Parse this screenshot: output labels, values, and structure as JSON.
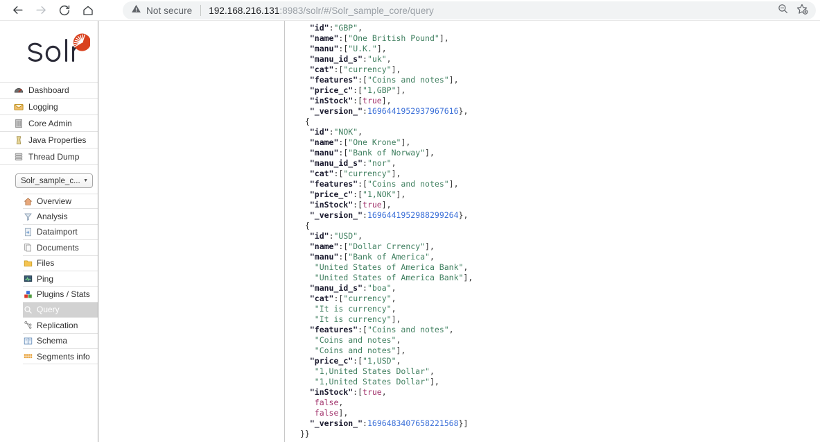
{
  "browser": {
    "back_icon": "back-arrow-icon",
    "forward_icon": "forward-arrow-icon",
    "reload_icon": "reload-icon",
    "home_icon": "home-icon",
    "security_icon": "not-secure-warning-icon",
    "security_label": "Not secure",
    "url_host": "192.168.216.131",
    "url_path": ":8983/solr/#/Solr_sample_core/query",
    "url_full": "192.168.216.131:8983/solr/#/Solr_sample_core/query",
    "zoom_out_icon": "zoom-out-icon",
    "favorite_icon": "add-to-favorites-star-icon"
  },
  "sidebar": {
    "logo_text": "Solr",
    "main_nav": [
      {
        "label": "Dashboard",
        "icon": "dashboard-icon"
      },
      {
        "label": "Logging",
        "icon": "logging-icon"
      },
      {
        "label": "Core Admin",
        "icon": "core-admin-icon"
      },
      {
        "label": "Java Properties",
        "icon": "java-properties-icon"
      },
      {
        "label": "Thread Dump",
        "icon": "thread-dump-icon"
      }
    ],
    "core_selector": {
      "value": "Solr_sample_c...",
      "caret": "▼"
    },
    "core_nav": [
      {
        "label": "Overview",
        "icon": "overview-icon",
        "active": false
      },
      {
        "label": "Analysis",
        "icon": "analysis-icon",
        "active": false
      },
      {
        "label": "Dataimport",
        "icon": "dataimport-icon",
        "active": false
      },
      {
        "label": "Documents",
        "icon": "documents-icon",
        "active": false
      },
      {
        "label": "Files",
        "icon": "files-folder-icon",
        "active": false
      },
      {
        "label": "Ping",
        "icon": "ping-icon",
        "active": false
      },
      {
        "label": "Plugins / Stats",
        "icon": "plugins-stats-icon",
        "active": false
      },
      {
        "label": "Query",
        "icon": "query-magnifier-icon",
        "active": true
      },
      {
        "label": "Replication",
        "icon": "replication-icon",
        "active": false
      },
      {
        "label": "Schema",
        "icon": "schema-book-icon",
        "active": false
      },
      {
        "label": "Segments info",
        "icon": "segments-info-icon",
        "active": false
      }
    ]
  },
  "response": {
    "lines": [
      [
        {
          "t": "key",
          "v": "\"id\""
        },
        {
          "t": "punct",
          "v": ":"
        },
        {
          "t": "str",
          "v": "\"GBP\""
        },
        {
          "t": "punct",
          "v": ","
        }
      ],
      [
        {
          "t": "key",
          "v": "\"name\""
        },
        {
          "t": "punct",
          "v": ":["
        },
        {
          "t": "str",
          "v": "\"One British Pound\""
        },
        {
          "t": "punct",
          "v": "],"
        }
      ],
      [
        {
          "t": "key",
          "v": "\"manu\""
        },
        {
          "t": "punct",
          "v": ":["
        },
        {
          "t": "str",
          "v": "\"U.K.\""
        },
        {
          "t": "punct",
          "v": "],"
        }
      ],
      [
        {
          "t": "key",
          "v": "\"manu_id_s\""
        },
        {
          "t": "punct",
          "v": ":"
        },
        {
          "t": "str",
          "v": "\"uk\""
        },
        {
          "t": "punct",
          "v": ","
        }
      ],
      [
        {
          "t": "key",
          "v": "\"cat\""
        },
        {
          "t": "punct",
          "v": ":["
        },
        {
          "t": "str",
          "v": "\"currency\""
        },
        {
          "t": "punct",
          "v": "],"
        }
      ],
      [
        {
          "t": "key",
          "v": "\"features\""
        },
        {
          "t": "punct",
          "v": ":["
        },
        {
          "t": "str",
          "v": "\"Coins and notes\""
        },
        {
          "t": "punct",
          "v": "],"
        }
      ],
      [
        {
          "t": "key",
          "v": "\"price_c\""
        },
        {
          "t": "punct",
          "v": ":["
        },
        {
          "t": "str",
          "v": "\"1,GBP\""
        },
        {
          "t": "punct",
          "v": "],"
        }
      ],
      [
        {
          "t": "key",
          "v": "\"inStock\""
        },
        {
          "t": "punct",
          "v": ":["
        },
        {
          "t": "bool",
          "v": "true"
        },
        {
          "t": "punct",
          "v": "],"
        }
      ],
      [
        {
          "t": "key",
          "v": "\"_version_\""
        },
        {
          "t": "punct",
          "v": ":"
        },
        {
          "t": "num",
          "v": "1696441952937967616"
        },
        {
          "t": "punct",
          "v": "},"
        }
      ],
      [
        {
          "t": "brace",
          "v": "{",
          "indent": -1
        }
      ],
      [
        {
          "t": "key",
          "v": "\"id\""
        },
        {
          "t": "punct",
          "v": ":"
        },
        {
          "t": "str",
          "v": "\"NOK\""
        },
        {
          "t": "punct",
          "v": ","
        }
      ],
      [
        {
          "t": "key",
          "v": "\"name\""
        },
        {
          "t": "punct",
          "v": ":["
        },
        {
          "t": "str",
          "v": "\"One Krone\""
        },
        {
          "t": "punct",
          "v": "],"
        }
      ],
      [
        {
          "t": "key",
          "v": "\"manu\""
        },
        {
          "t": "punct",
          "v": ":["
        },
        {
          "t": "str",
          "v": "\"Bank of Norway\""
        },
        {
          "t": "punct",
          "v": "],"
        }
      ],
      [
        {
          "t": "key",
          "v": "\"manu_id_s\""
        },
        {
          "t": "punct",
          "v": ":"
        },
        {
          "t": "str",
          "v": "\"nor\""
        },
        {
          "t": "punct",
          "v": ","
        }
      ],
      [
        {
          "t": "key",
          "v": "\"cat\""
        },
        {
          "t": "punct",
          "v": ":["
        },
        {
          "t": "str",
          "v": "\"currency\""
        },
        {
          "t": "punct",
          "v": "],"
        }
      ],
      [
        {
          "t": "key",
          "v": "\"features\""
        },
        {
          "t": "punct",
          "v": ":["
        },
        {
          "t": "str",
          "v": "\"Coins and notes\""
        },
        {
          "t": "punct",
          "v": "],"
        }
      ],
      [
        {
          "t": "key",
          "v": "\"price_c\""
        },
        {
          "t": "punct",
          "v": ":["
        },
        {
          "t": "str",
          "v": "\"1,NOK\""
        },
        {
          "t": "punct",
          "v": "],"
        }
      ],
      [
        {
          "t": "key",
          "v": "\"inStock\""
        },
        {
          "t": "punct",
          "v": ":["
        },
        {
          "t": "bool",
          "v": "true"
        },
        {
          "t": "punct",
          "v": "],"
        }
      ],
      [
        {
          "t": "key",
          "v": "\"_version_\""
        },
        {
          "t": "punct",
          "v": ":"
        },
        {
          "t": "num",
          "v": "1696441952988299264"
        },
        {
          "t": "punct",
          "v": "},"
        }
      ],
      [
        {
          "t": "brace",
          "v": "{",
          "indent": -1
        }
      ],
      [
        {
          "t": "key",
          "v": "\"id\""
        },
        {
          "t": "punct",
          "v": ":"
        },
        {
          "t": "str",
          "v": "\"USD\""
        },
        {
          "t": "punct",
          "v": ","
        }
      ],
      [
        {
          "t": "key",
          "v": "\"name\""
        },
        {
          "t": "punct",
          "v": ":["
        },
        {
          "t": "str",
          "v": "\"Dollar Crrency\""
        },
        {
          "t": "punct",
          "v": "],"
        }
      ],
      [
        {
          "t": "key",
          "v": "\"manu\""
        },
        {
          "t": "punct",
          "v": ":["
        },
        {
          "t": "str",
          "v": "\"Bank of America\""
        },
        {
          "t": "punct",
          "v": ","
        }
      ],
      [
        {
          "t": "str",
          "v": "\"United States of America Bank\"",
          "indent": 1
        },
        {
          "t": "punct",
          "v": ","
        }
      ],
      [
        {
          "t": "str",
          "v": "\"United States of America Bank\"",
          "indent": 1
        },
        {
          "t": "punct",
          "v": "],"
        }
      ],
      [
        {
          "t": "key",
          "v": "\"manu_id_s\""
        },
        {
          "t": "punct",
          "v": ":"
        },
        {
          "t": "str",
          "v": "\"boa\""
        },
        {
          "t": "punct",
          "v": ","
        }
      ],
      [
        {
          "t": "key",
          "v": "\"cat\""
        },
        {
          "t": "punct",
          "v": ":["
        },
        {
          "t": "str",
          "v": "\"currency\""
        },
        {
          "t": "punct",
          "v": ","
        }
      ],
      [
        {
          "t": "str",
          "v": "\"It is currency\"",
          "indent": 1
        },
        {
          "t": "punct",
          "v": ","
        }
      ],
      [
        {
          "t": "str",
          "v": "\"It is currency\"",
          "indent": 1
        },
        {
          "t": "punct",
          "v": "],"
        }
      ],
      [
        {
          "t": "key",
          "v": "\"features\""
        },
        {
          "t": "punct",
          "v": ":["
        },
        {
          "t": "str",
          "v": "\"Coins and notes\""
        },
        {
          "t": "punct",
          "v": ","
        }
      ],
      [
        {
          "t": "str",
          "v": "\"Coins and notes\"",
          "indent": 1
        },
        {
          "t": "punct",
          "v": ","
        }
      ],
      [
        {
          "t": "str",
          "v": "\"Coins and notes\"",
          "indent": 1
        },
        {
          "t": "punct",
          "v": "],"
        }
      ],
      [
        {
          "t": "key",
          "v": "\"price_c\""
        },
        {
          "t": "punct",
          "v": ":["
        },
        {
          "t": "str",
          "v": "\"1,USD\""
        },
        {
          "t": "punct",
          "v": ","
        }
      ],
      [
        {
          "t": "str",
          "v": "\"1,United States Dollar\"",
          "indent": 1
        },
        {
          "t": "punct",
          "v": ","
        }
      ],
      [
        {
          "t": "str",
          "v": "\"1,United States Dollar\"",
          "indent": 1
        },
        {
          "t": "punct",
          "v": "],"
        }
      ],
      [
        {
          "t": "key",
          "v": "\"inStock\""
        },
        {
          "t": "punct",
          "v": ":["
        },
        {
          "t": "bool",
          "v": "true"
        },
        {
          "t": "punct",
          "v": ","
        }
      ],
      [
        {
          "t": "bool",
          "v": "false",
          "indent": 1
        },
        {
          "t": "punct",
          "v": ","
        }
      ],
      [
        {
          "t": "bool",
          "v": "false",
          "indent": 1
        },
        {
          "t": "punct",
          "v": "],"
        }
      ],
      [
        {
          "t": "key",
          "v": "\"_version_\""
        },
        {
          "t": "punct",
          "v": ":"
        },
        {
          "t": "num",
          "v": "1696483407658221568"
        },
        {
          "t": "punct",
          "v": "}]"
        }
      ],
      [
        {
          "t": "brace",
          "v": "}}",
          "indent": -3
        }
      ]
    ]
  },
  "colors": {
    "json_key": "#1a1a2e",
    "json_string": "#3f7f5f",
    "json_number": "#3a6fd8",
    "json_boolean": "#a0306a",
    "solr_red": "#d9411e",
    "active_nav_bg": "#d2d2d2",
    "omnibox_bg": "#f1f3f4"
  }
}
